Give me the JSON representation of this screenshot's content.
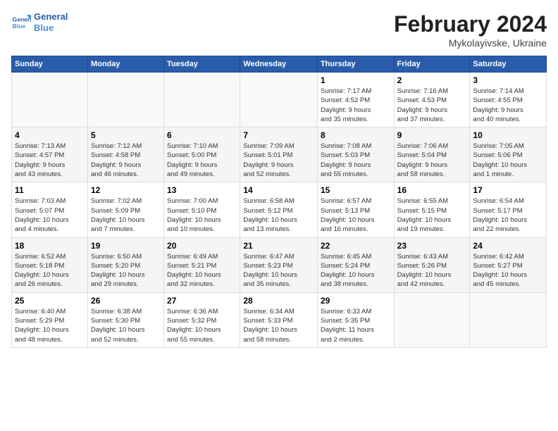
{
  "header": {
    "logo_line1": "General",
    "logo_line2": "Blue",
    "month_title": "February 2024",
    "subtitle": "Mykolayivske, Ukraine"
  },
  "weekdays": [
    "Sunday",
    "Monday",
    "Tuesday",
    "Wednesday",
    "Thursday",
    "Friday",
    "Saturday"
  ],
  "weeks": [
    [
      {
        "day": "",
        "info": ""
      },
      {
        "day": "",
        "info": ""
      },
      {
        "day": "",
        "info": ""
      },
      {
        "day": "",
        "info": ""
      },
      {
        "day": "1",
        "info": "Sunrise: 7:17 AM\nSunset: 4:52 PM\nDaylight: 9 hours\nand 35 minutes."
      },
      {
        "day": "2",
        "info": "Sunrise: 7:16 AM\nSunset: 4:53 PM\nDaylight: 9 hours\nand 37 minutes."
      },
      {
        "day": "3",
        "info": "Sunrise: 7:14 AM\nSunset: 4:55 PM\nDaylight: 9 hours\nand 40 minutes."
      }
    ],
    [
      {
        "day": "4",
        "info": "Sunrise: 7:13 AM\nSunset: 4:57 PM\nDaylight: 9 hours\nand 43 minutes."
      },
      {
        "day": "5",
        "info": "Sunrise: 7:12 AM\nSunset: 4:58 PM\nDaylight: 9 hours\nand 46 minutes."
      },
      {
        "day": "6",
        "info": "Sunrise: 7:10 AM\nSunset: 5:00 PM\nDaylight: 9 hours\nand 49 minutes."
      },
      {
        "day": "7",
        "info": "Sunrise: 7:09 AM\nSunset: 5:01 PM\nDaylight: 9 hours\nand 52 minutes."
      },
      {
        "day": "8",
        "info": "Sunrise: 7:08 AM\nSunset: 5:03 PM\nDaylight: 9 hours\nand 55 minutes."
      },
      {
        "day": "9",
        "info": "Sunrise: 7:06 AM\nSunset: 5:04 PM\nDaylight: 9 hours\nand 58 minutes."
      },
      {
        "day": "10",
        "info": "Sunrise: 7:05 AM\nSunset: 5:06 PM\nDaylight: 10 hours\nand 1 minute."
      }
    ],
    [
      {
        "day": "11",
        "info": "Sunrise: 7:03 AM\nSunset: 5:07 PM\nDaylight: 10 hours\nand 4 minutes."
      },
      {
        "day": "12",
        "info": "Sunrise: 7:02 AM\nSunset: 5:09 PM\nDaylight: 10 hours\nand 7 minutes."
      },
      {
        "day": "13",
        "info": "Sunrise: 7:00 AM\nSunset: 5:10 PM\nDaylight: 10 hours\nand 10 minutes."
      },
      {
        "day": "14",
        "info": "Sunrise: 6:58 AM\nSunset: 5:12 PM\nDaylight: 10 hours\nand 13 minutes."
      },
      {
        "day": "15",
        "info": "Sunrise: 6:57 AM\nSunset: 5:13 PM\nDaylight: 10 hours\nand 16 minutes."
      },
      {
        "day": "16",
        "info": "Sunrise: 6:55 AM\nSunset: 5:15 PM\nDaylight: 10 hours\nand 19 minutes."
      },
      {
        "day": "17",
        "info": "Sunrise: 6:54 AM\nSunset: 5:17 PM\nDaylight: 10 hours\nand 22 minutes."
      }
    ],
    [
      {
        "day": "18",
        "info": "Sunrise: 6:52 AM\nSunset: 5:18 PM\nDaylight: 10 hours\nand 26 minutes."
      },
      {
        "day": "19",
        "info": "Sunrise: 6:50 AM\nSunset: 5:20 PM\nDaylight: 10 hours\nand 29 minutes."
      },
      {
        "day": "20",
        "info": "Sunrise: 6:49 AM\nSunset: 5:21 PM\nDaylight: 10 hours\nand 32 minutes."
      },
      {
        "day": "21",
        "info": "Sunrise: 6:47 AM\nSunset: 5:23 PM\nDaylight: 10 hours\nand 35 minutes."
      },
      {
        "day": "22",
        "info": "Sunrise: 6:45 AM\nSunset: 5:24 PM\nDaylight: 10 hours\nand 38 minutes."
      },
      {
        "day": "23",
        "info": "Sunrise: 6:43 AM\nSunset: 5:26 PM\nDaylight: 10 hours\nand 42 minutes."
      },
      {
        "day": "24",
        "info": "Sunrise: 6:42 AM\nSunset: 5:27 PM\nDaylight: 10 hours\nand 45 minutes."
      }
    ],
    [
      {
        "day": "25",
        "info": "Sunrise: 6:40 AM\nSunset: 5:29 PM\nDaylight: 10 hours\nand 48 minutes."
      },
      {
        "day": "26",
        "info": "Sunrise: 6:38 AM\nSunset: 5:30 PM\nDaylight: 10 hours\nand 52 minutes."
      },
      {
        "day": "27",
        "info": "Sunrise: 6:36 AM\nSunset: 5:32 PM\nDaylight: 10 hours\nand 55 minutes."
      },
      {
        "day": "28",
        "info": "Sunrise: 6:34 AM\nSunset: 5:33 PM\nDaylight: 10 hours\nand 58 minutes."
      },
      {
        "day": "29",
        "info": "Sunrise: 6:33 AM\nSunset: 5:35 PM\nDaylight: 11 hours\nand 2 minutes."
      },
      {
        "day": "",
        "info": ""
      },
      {
        "day": "",
        "info": ""
      }
    ]
  ]
}
